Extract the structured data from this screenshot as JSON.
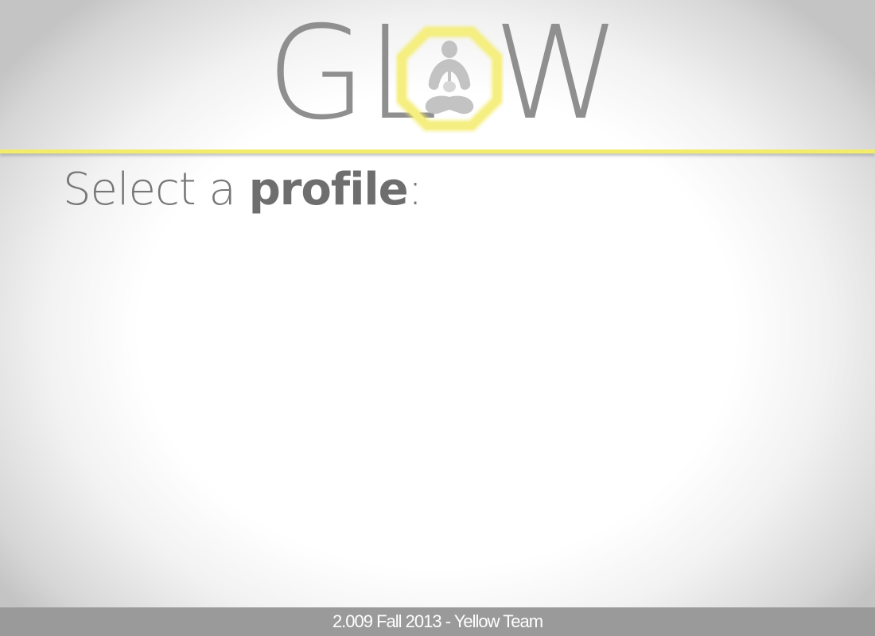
{
  "header": {
    "logo": {
      "text_left": "GL",
      "text_right": "W",
      "emblem_icon": "yoga-lotus-icon"
    },
    "accent_color": "#f3ec6a"
  },
  "main": {
    "prompt_regular": "Select a ",
    "prompt_bold": "profile",
    "prompt_suffix": ":",
    "profiles": []
  },
  "footer": {
    "text": "2.009 Fall 2013 - Yellow Team"
  }
}
